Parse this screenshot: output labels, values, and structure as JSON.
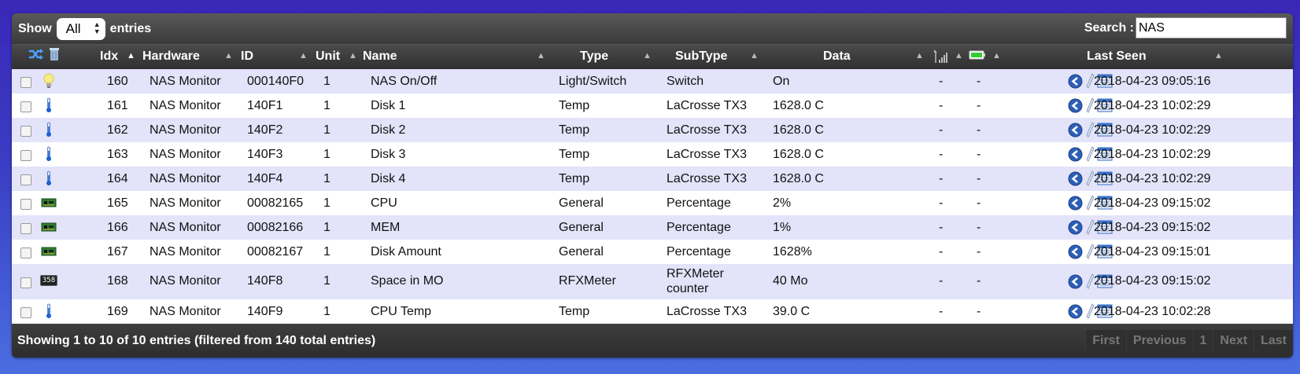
{
  "controls": {
    "show_label": "Show",
    "length_value": "All",
    "entries_label": "entries",
    "search_label": "Search :",
    "search_value": "NAS"
  },
  "columns": {
    "idx": "Idx",
    "hardware": "Hardware",
    "id": "ID",
    "unit": "Unit",
    "name": "Name",
    "type": "Type",
    "subtype": "SubType",
    "data": "Data",
    "lastseen": "Last Seen"
  },
  "rows": [
    {
      "icon": "lightbulb-icon",
      "idx": "160",
      "hardware": "NAS Monitor",
      "id": "000140F0",
      "unit": "1",
      "name": "NAS On/Off",
      "type": "Light/Switch",
      "subtype": "Switch",
      "data": "On",
      "signal": "-",
      "battery": "-",
      "lastseen": "2018-04-23 09:05:16"
    },
    {
      "icon": "thermometer-icon",
      "idx": "161",
      "hardware": "NAS Monitor",
      "id": "140F1",
      "unit": "1",
      "name": "Disk 1",
      "type": "Temp",
      "subtype": "LaCrosse TX3",
      "data": "1628.0 C",
      "signal": "-",
      "battery": "-",
      "lastseen": "2018-04-23 10:02:29"
    },
    {
      "icon": "thermometer-icon",
      "idx": "162",
      "hardware": "NAS Monitor",
      "id": "140F2",
      "unit": "1",
      "name": "Disk 2",
      "type": "Temp",
      "subtype": "LaCrosse TX3",
      "data": "1628.0 C",
      "signal": "-",
      "battery": "-",
      "lastseen": "2018-04-23 10:02:29"
    },
    {
      "icon": "thermometer-icon",
      "idx": "163",
      "hardware": "NAS Monitor",
      "id": "140F3",
      "unit": "1",
      "name": "Disk 3",
      "type": "Temp",
      "subtype": "LaCrosse TX3",
      "data": "1628.0 C",
      "signal": "-",
      "battery": "-",
      "lastseen": "2018-04-23 10:02:29"
    },
    {
      "icon": "thermometer-icon",
      "idx": "164",
      "hardware": "NAS Monitor",
      "id": "140F4",
      "unit": "1",
      "name": "Disk 4",
      "type": "Temp",
      "subtype": "LaCrosse TX3",
      "data": "1628.0 C",
      "signal": "-",
      "battery": "-",
      "lastseen": "2018-04-23 10:02:29"
    },
    {
      "icon": "circuit-board-icon",
      "idx": "165",
      "hardware": "NAS Monitor",
      "id": "00082165",
      "unit": "1",
      "name": "CPU",
      "type": "General",
      "subtype": "Percentage",
      "data": "2%",
      "signal": "-",
      "battery": "-",
      "lastseen": "2018-04-23 09:15:02"
    },
    {
      "icon": "circuit-board-icon",
      "idx": "166",
      "hardware": "NAS Monitor",
      "id": "00082166",
      "unit": "1",
      "name": "MEM",
      "type": "General",
      "subtype": "Percentage",
      "data": "1%",
      "signal": "-",
      "battery": "-",
      "lastseen": "2018-04-23 09:15:02"
    },
    {
      "icon": "circuit-board-icon",
      "idx": "167",
      "hardware": "NAS Monitor",
      "id": "00082167",
      "unit": "1",
      "name": "Disk Amount",
      "type": "General",
      "subtype": "Percentage",
      "data": "1628%",
      "signal": "-",
      "battery": "-",
      "lastseen": "2018-04-23 09:15:01"
    },
    {
      "icon": "counter-icon",
      "icon_text": "358",
      "idx": "168",
      "hardware": "NAS Monitor",
      "id": "140F8",
      "unit": "1",
      "name": "Space in MO",
      "type": "RFXMeter",
      "subtype": "RFXMeter counter",
      "data": "40 Mo",
      "signal": "-",
      "battery": "-",
      "lastseen": "2018-04-23 09:15:02"
    },
    {
      "icon": "thermometer-icon",
      "idx": "169",
      "hardware": "NAS Monitor",
      "id": "140F9",
      "unit": "1",
      "name": "CPU Temp",
      "type": "Temp",
      "subtype": "LaCrosse TX3",
      "data": "39.0 C",
      "signal": "-",
      "battery": "-",
      "lastseen": "2018-04-23 10:02:28"
    }
  ],
  "footer": {
    "info": "Showing 1 to 10 of 10 entries (filtered from 140 total entries)",
    "pages": [
      "First",
      "Previous",
      "1",
      "Next",
      "Last"
    ]
  },
  "colors": {
    "row_odd": "#e3e3fa",
    "row_even": "#ffffff",
    "header_bg": "#3a3a3a",
    "action_blue": "#2d5fb8"
  }
}
